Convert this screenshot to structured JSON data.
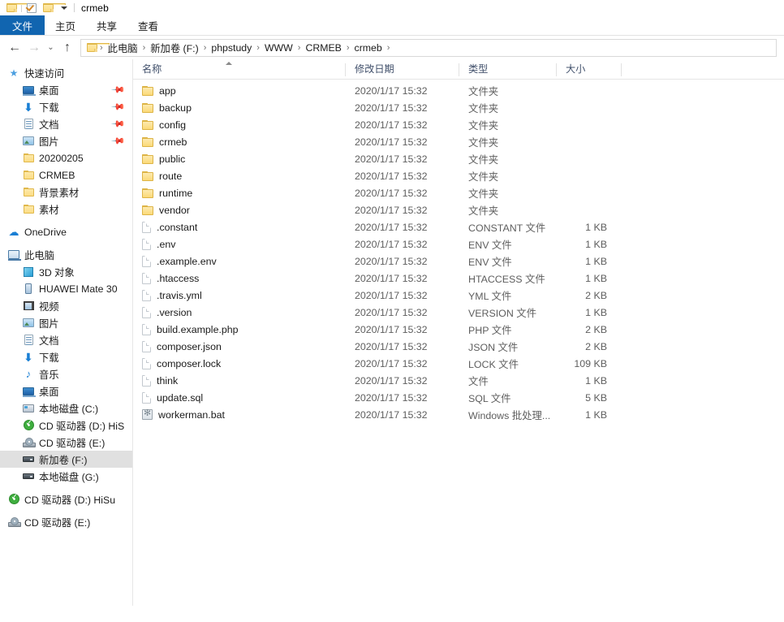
{
  "titlebar": {
    "title": "crmeb",
    "icons": [
      "folder-icon",
      "properties-icon",
      "new-folder-icon",
      "customize-dropdown-icon"
    ]
  },
  "ribbon": {
    "tabs": [
      {
        "label": "文件",
        "active": true
      },
      {
        "label": "主页",
        "active": false
      },
      {
        "label": "共享",
        "active": false
      },
      {
        "label": "查看",
        "active": false
      }
    ],
    "accent_color": "#1165b0"
  },
  "address": {
    "nav": {
      "back": "←",
      "forward": "→",
      "recent": "⌄",
      "up": "↑"
    },
    "crumbs": [
      "此电脑",
      "新加卷 (F:)",
      "phpstudy",
      "WWW",
      "CRMEB",
      "crmeb"
    ],
    "separator": "›"
  },
  "sidebar": {
    "groups": [
      {
        "header": {
          "label": "快速访问",
          "icon": "star-pin-icon",
          "level": 0
        },
        "items": [
          {
            "label": "桌面",
            "icon": "desktop-icon",
            "level": 1,
            "pinned": true
          },
          {
            "label": "下载",
            "icon": "download-icon",
            "level": 1,
            "pinned": true
          },
          {
            "label": "文档",
            "icon": "documents-icon",
            "level": 1,
            "pinned": true
          },
          {
            "label": "图片",
            "icon": "pictures-icon",
            "level": 1,
            "pinned": true
          },
          {
            "label": "20200205",
            "icon": "folder-icon",
            "level": 1,
            "pinned": false
          },
          {
            "label": "CRMEB",
            "icon": "folder-icon",
            "level": 1,
            "pinned": false
          },
          {
            "label": "背景素材",
            "icon": "folder-icon",
            "level": 1,
            "pinned": false
          },
          {
            "label": "素材",
            "icon": "folder-icon",
            "level": 1,
            "pinned": false
          }
        ]
      },
      {
        "header": {
          "label": "OneDrive",
          "icon": "cloud-icon",
          "level": 0
        },
        "items": []
      },
      {
        "header": {
          "label": "此电脑",
          "icon": "this-pc-icon",
          "level": 0
        },
        "items": [
          {
            "label": "3D 对象",
            "icon": "3d-objects-icon",
            "level": 1,
            "selected": false
          },
          {
            "label": "HUAWEI Mate 30",
            "icon": "phone-icon",
            "level": 1,
            "selected": false
          },
          {
            "label": "视频",
            "icon": "videos-icon",
            "level": 1,
            "selected": false
          },
          {
            "label": "图片",
            "icon": "pictures-icon",
            "level": 1,
            "selected": false
          },
          {
            "label": "文档",
            "icon": "documents-icon",
            "level": 1,
            "selected": false
          },
          {
            "label": "下载",
            "icon": "download-icon",
            "level": 1,
            "selected": false
          },
          {
            "label": "音乐",
            "icon": "music-icon",
            "level": 1,
            "selected": false
          },
          {
            "label": "桌面",
            "icon": "desktop-icon",
            "level": 1,
            "selected": false
          },
          {
            "label": "本地磁盘 (C:)",
            "icon": "hard-disk-icon",
            "level": 1,
            "selected": false
          },
          {
            "label": "CD 驱动器 (D:) HiS",
            "icon": "cd-drive-green-icon",
            "level": 1,
            "selected": false
          },
          {
            "label": "CD 驱动器 (E:)",
            "icon": "cd-drive-icon",
            "level": 1,
            "selected": false
          },
          {
            "label": "新加卷 (F:)",
            "icon": "volume-icon",
            "level": 1,
            "selected": true
          },
          {
            "label": "本地磁盘 (G:)",
            "icon": "volume-icon",
            "level": 1,
            "selected": false
          }
        ]
      },
      {
        "header": {
          "label": "CD 驱动器 (D:) HiSu",
          "icon": "cd-drive-green-icon",
          "level": 0
        },
        "items": []
      },
      {
        "header": {
          "label": "CD 驱动器 (E:)",
          "icon": "cd-drive-icon",
          "level": 0
        },
        "items": []
      }
    ],
    "selected_highlight": "#e0e0e0"
  },
  "filelist": {
    "columns": [
      {
        "label": "名称",
        "sorted": "asc"
      },
      {
        "label": "修改日期",
        "sorted": ""
      },
      {
        "label": "类型",
        "sorted": ""
      },
      {
        "label": "大小",
        "sorted": ""
      }
    ],
    "rows": [
      {
        "name": "app",
        "date": "2020/1/17 15:32",
        "type": "文件夹",
        "size": "",
        "icon": "folder-icon"
      },
      {
        "name": "backup",
        "date": "2020/1/17 15:32",
        "type": "文件夹",
        "size": "",
        "icon": "folder-icon"
      },
      {
        "name": "config",
        "date": "2020/1/17 15:32",
        "type": "文件夹",
        "size": "",
        "icon": "folder-icon"
      },
      {
        "name": "crmeb",
        "date": "2020/1/17 15:32",
        "type": "文件夹",
        "size": "",
        "icon": "folder-icon"
      },
      {
        "name": "public",
        "date": "2020/1/17 15:32",
        "type": "文件夹",
        "size": "",
        "icon": "folder-icon"
      },
      {
        "name": "route",
        "date": "2020/1/17 15:32",
        "type": "文件夹",
        "size": "",
        "icon": "folder-icon"
      },
      {
        "name": "runtime",
        "date": "2020/1/17 15:32",
        "type": "文件夹",
        "size": "",
        "icon": "folder-icon"
      },
      {
        "name": "vendor",
        "date": "2020/1/17 15:32",
        "type": "文件夹",
        "size": "",
        "icon": "folder-icon"
      },
      {
        "name": ".constant",
        "date": "2020/1/17 15:32",
        "type": "CONSTANT 文件",
        "size": "1 KB",
        "icon": "file-icon"
      },
      {
        "name": ".env",
        "date": "2020/1/17 15:32",
        "type": "ENV 文件",
        "size": "1 KB",
        "icon": "file-icon"
      },
      {
        "name": ".example.env",
        "date": "2020/1/17 15:32",
        "type": "ENV 文件",
        "size": "1 KB",
        "icon": "file-icon"
      },
      {
        "name": ".htaccess",
        "date": "2020/1/17 15:32",
        "type": "HTACCESS 文件",
        "size": "1 KB",
        "icon": "file-icon"
      },
      {
        "name": ".travis.yml",
        "date": "2020/1/17 15:32",
        "type": "YML 文件",
        "size": "2 KB",
        "icon": "file-icon"
      },
      {
        "name": ".version",
        "date": "2020/1/17 15:32",
        "type": "VERSION 文件",
        "size": "1 KB",
        "icon": "file-icon"
      },
      {
        "name": "build.example.php",
        "date": "2020/1/17 15:32",
        "type": "PHP 文件",
        "size": "2 KB",
        "icon": "file-icon"
      },
      {
        "name": "composer.json",
        "date": "2020/1/17 15:32",
        "type": "JSON 文件",
        "size": "2 KB",
        "icon": "file-icon"
      },
      {
        "name": "composer.lock",
        "date": "2020/1/17 15:32",
        "type": "LOCK 文件",
        "size": "109 KB",
        "icon": "file-icon"
      },
      {
        "name": "think",
        "date": "2020/1/17 15:32",
        "type": "文件",
        "size": "1 KB",
        "icon": "file-icon"
      },
      {
        "name": "update.sql",
        "date": "2020/1/17 15:32",
        "type": "SQL 文件",
        "size": "5 KB",
        "icon": "file-icon"
      },
      {
        "name": "workerman.bat",
        "date": "2020/1/17 15:32",
        "type": "Windows 批处理...",
        "size": "1 KB",
        "icon": "bat-file-icon"
      }
    ]
  }
}
